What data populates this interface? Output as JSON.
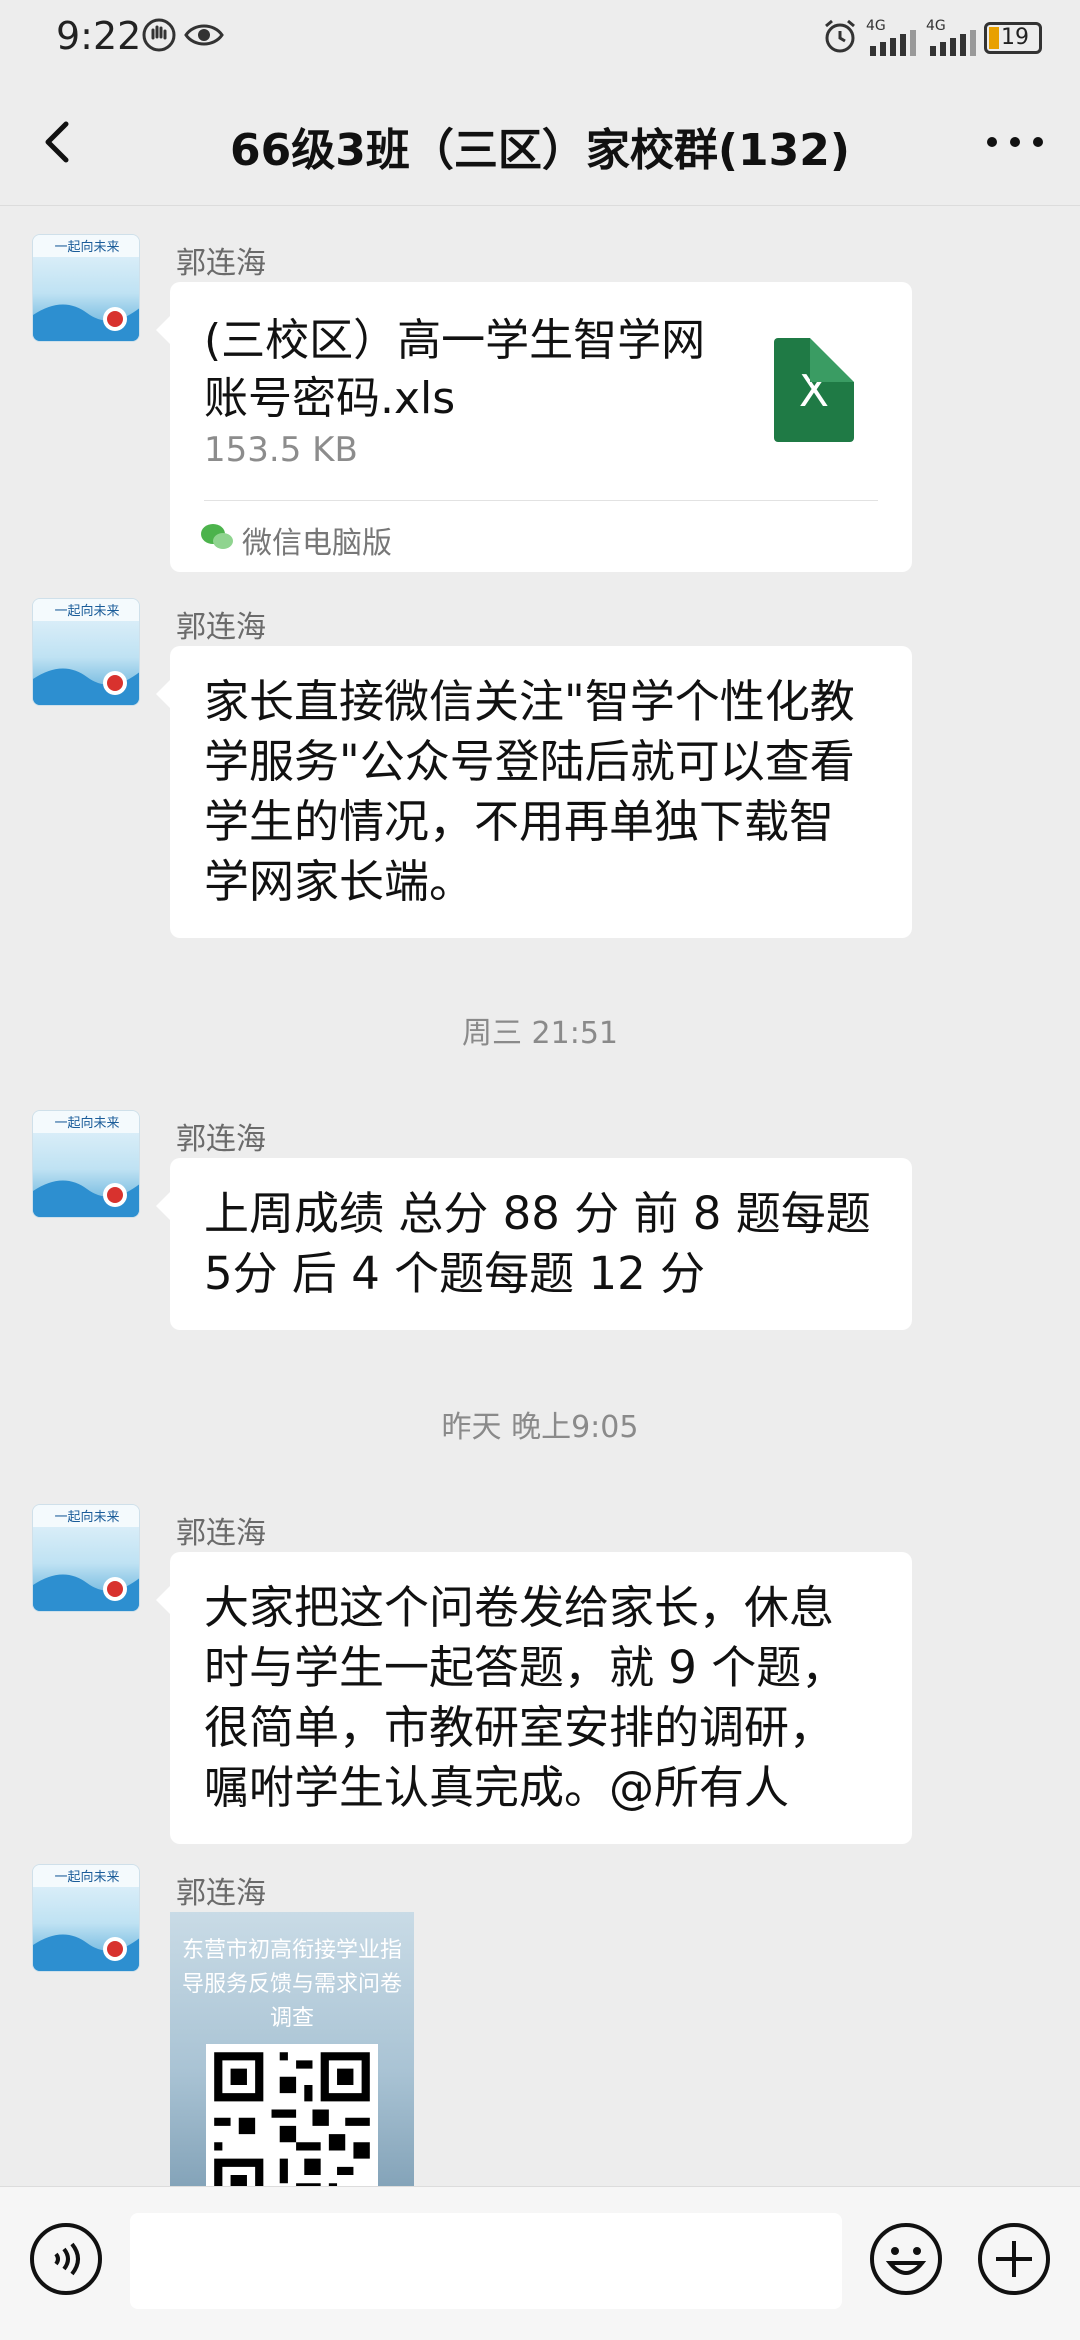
{
  "status_bar": {
    "time": "9:22",
    "battery_level": "19",
    "network_labels": [
      "4G",
      "4G"
    ]
  },
  "header": {
    "title": "66级3班（三区）家校群(132)"
  },
  "messages": [
    {
      "sender": "郭连海",
      "type": "file",
      "file_name": "(三校区）高一学生智学网账号密码.xls",
      "file_size": "153.5 KB",
      "file_icon_letter": "X",
      "source_label": "微信电脑版"
    },
    {
      "sender": "郭连海",
      "type": "text",
      "text": "家长直接微信关注\"智学个性化教学服务\"公众号登陆后就可以查看学生的情况，不用再单独下载智学网家长端。"
    },
    {
      "timestamp": "周三 21:51"
    },
    {
      "sender": "郭连海",
      "type": "text",
      "text": "上周成绩  总分 88 分   前 8 题每题 5分  后 4 个题每题 12 分"
    },
    {
      "timestamp": "昨天 晚上9:05"
    },
    {
      "sender": "郭连海",
      "type": "text",
      "text": "大家把这个问卷发给家长，休息时与学生一起答题，就 9 个题，很简单，市教研室安排的调研，嘱咐学生认真完成。@所有人"
    },
    {
      "sender": "郭连海",
      "type": "image",
      "image_title": "东营市初高衔接学业指导服务反馈与需求问卷调查"
    }
  ],
  "input_bar": {
    "text_value": "",
    "icons": [
      "voice-icon",
      "emoji-icon",
      "plus-icon"
    ]
  },
  "colors": {
    "background": "#ededed",
    "bubble": "#ffffff",
    "excel_green": "#1f7a45"
  }
}
